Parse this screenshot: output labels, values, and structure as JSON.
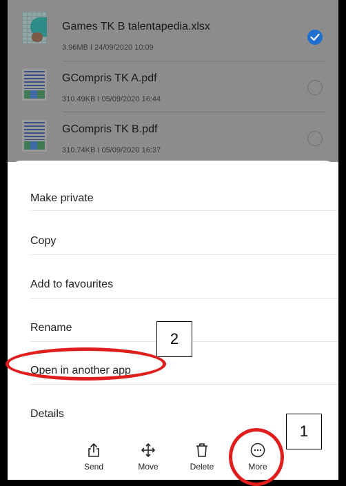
{
  "files": [
    {
      "name": "Games TK B talentapedia.xlsx",
      "meta": "3.96MB  I  24/09/2020 10:09",
      "selected": true,
      "thumb": "spreadsheet-thumbnail"
    },
    {
      "name": "GCompris TK A.pdf",
      "meta": "310.49KB  I  05/09/2020 16:44",
      "selected": false,
      "thumb": "pdf-thumbnail"
    },
    {
      "name": "GCompris TK B.pdf",
      "meta": "310.74KB  I  05/09/2020 16:37",
      "selected": false,
      "thumb": "pdf-thumbnail"
    }
  ],
  "menu": {
    "items": [
      {
        "label": "Make private"
      },
      {
        "label": "Copy"
      },
      {
        "label": "Add to favourites"
      },
      {
        "label": "Rename"
      },
      {
        "label": "Open in another app"
      },
      {
        "label": "Details"
      }
    ]
  },
  "toolbar": {
    "send": {
      "label": "Send",
      "icon": "share-icon"
    },
    "move": {
      "label": "Move",
      "icon": "move-arrows-icon"
    },
    "delete": {
      "label": "Delete",
      "icon": "trash-icon"
    },
    "more": {
      "label": "More",
      "icon": "more-dots-icon"
    }
  },
  "annotations": {
    "step1": "1",
    "step2": "2",
    "highlight_color": "#e01e1e"
  },
  "colors": {
    "accent": "#1e6fd0",
    "dim_overlay": "#8c8c8c"
  }
}
